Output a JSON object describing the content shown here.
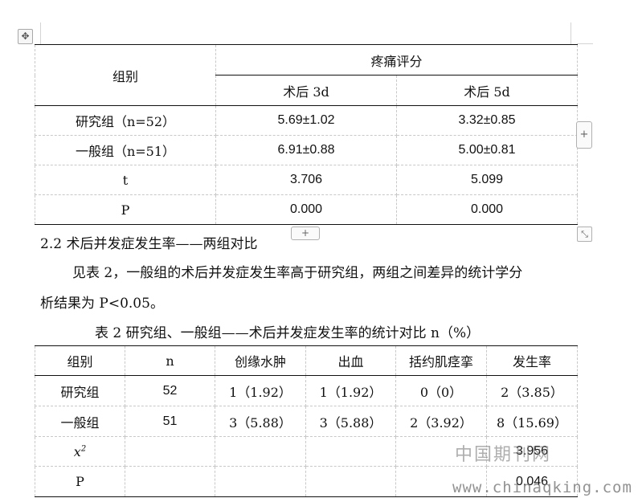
{
  "table1": {
    "header": {
      "group": "组别",
      "pain": "疼痛评分",
      "day3": "术后 3d",
      "day5": "术后 5d"
    },
    "rows": [
      {
        "label": "研究组（n=52）",
        "d3": "5.69±1.02",
        "d5": "3.32±0.85"
      },
      {
        "label": "一般组（n=51）",
        "d3": "6.91±0.88",
        "d5": "5.00±0.81"
      },
      {
        "label": "t",
        "d3": "3.706",
        "d5": "5.099"
      },
      {
        "label": "P",
        "d3": "0.000",
        "d5": "0.000"
      }
    ]
  },
  "heading": "2.2 术后并发症发生率——两组对比",
  "body_line1": "见表 2，一般组的术后并发症发生率高于研究组，两组之间差异的统计学分",
  "body_line2": "析结果为 P<0.05。",
  "caption": "表 2 研究组、一般组——术后并发症发生率的统计对比 n（%）",
  "table2": {
    "headers": [
      "组别",
      "n",
      "创缘水肿",
      "出血",
      "括约肌痉挛",
      "发生率"
    ],
    "rows": [
      [
        "研究组",
        "52",
        "1（1.92）",
        "1（1.92）",
        "0（0）",
        "2（3.85）"
      ],
      [
        "一般组",
        "51",
        "3（5.88）",
        "3（5.88）",
        "2（3.92）",
        "8（15.69）"
      ],
      [
        "x2",
        "",
        "",
        "",
        "",
        "3.956"
      ],
      [
        "P",
        "",
        "",
        "",
        "",
        "0.046"
      ]
    ]
  },
  "controls": {
    "move": "✥",
    "add": "+",
    "resize": "⤡"
  },
  "watermark": {
    "cn": "中国期刊网",
    "url": "www.chinaqking.com"
  }
}
